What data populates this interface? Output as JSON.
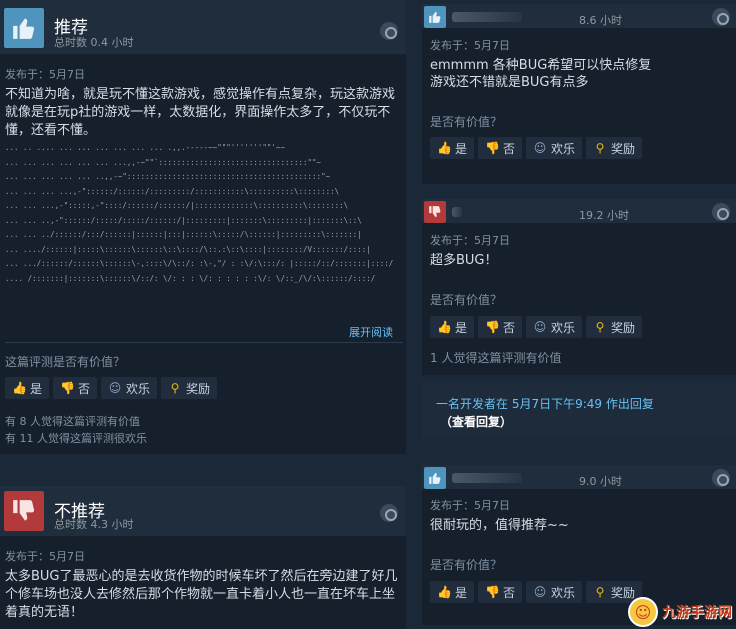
{
  "left": {
    "review1": {
      "verdict": "推荐",
      "hours": "总时数 0.4 小时",
      "posted": "发布于：5月7日",
      "text": "不知道为啥，就是玩不懂这款游戏，感觉操作有点复杂，玩这款游戏就像是在玩p社的游戏一样，太数据化，界面操作太多了，不仅玩不懂，还看不懂。",
      "ascii": [
        "... .. .... ... ... ... ... ... ... .,,.-----~~\"\"\"'''''''\"\"'~~",
        "... ... ... ... ... ... ...,,-~\"\"`:::::::::::::::::::::::::::::::::\"\"~",
        "... ... ... ... ... ..,,-~\":::::::::::::::::::::::::::::::::::::::::::\"~",
        "... ... ... ...,-\"::::::/::::::/:::::::::/:::::::::::\\::::::::::\\::::::::\\",
        "... ... ...,-\":::::,-\"::::/::::::/::::::/|:::::::::::::\\::::::::::\\::::::::\\",
        "... ... ..,-\"::::::/:::::/:::::/::::::/|:::::::::|:::::::\\:::::::::|:::::::\\::\\",
        "... ... ../::::::/:::/::::::|::::::|:::|::::::\\:::::/\\::::::|:::::::::\\:::::::|",
        "... ..../::::::|:::::\\::::::\\::::::\\::\\::::/\\::.:\\::\\::::|::::::::/V:::::::/::::|",
        "... .../::::::/::::::\\::::::\\-,::::\\/\\::/: :\\-,\"/ : :\\/:\\:::/: |:::::/::/:::::::|::::/",
        ".... /:::::::|:::::::\\::::::\\/::/: \\/: : : \\/: : : : : :\\/: \\/::_/\\/:\\::::::/::::/"
      ],
      "expand": "展开阅读",
      "question": "这篇评测是否有价值？",
      "buttons": {
        "yes": "是",
        "no": "否",
        "funny": "欢乐",
        "award": "奖励"
      },
      "stat1": "有 8 人觉得这篇评测有价值",
      "stat2": "有 11 人觉得这篇评测很欢乐"
    },
    "review2": {
      "verdict": "不推荐",
      "hours": "总时数 4.3 小时",
      "posted": "发布于：5月7日",
      "text": "太多BUG了最恶心的是去收货作物的时候车坏了然后在旁边建了好几个修车场也没人去修然后那个作物就一直卡着小人也一直在坏车上坐着真的无语！"
    }
  },
  "right": {
    "r1": {
      "hours": "8.6 小时",
      "posted": "发布于：5月7日",
      "line1": "emmmm 各种BUG希望可以快点修复",
      "line2": "游戏还不错就是BUG有点多",
      "question": "是否有价值？",
      "buttons": {
        "yes": "是",
        "no": "否",
        "funny": "欢乐",
        "award": "奖励"
      }
    },
    "r2": {
      "hours": "19.2 小时",
      "posted": "发布于：5月7日",
      "line1": "超多BUG！",
      "question": "是否有价值？",
      "buttons": {
        "yes": "是",
        "no": "否",
        "funny": "欢乐",
        "award": "奖励"
      },
      "stat": "1 人觉得这篇评测有价值",
      "dev_reply": "一名开发者在 5月7日下午9:49 作出回复",
      "dev_link": "（查看回复）"
    },
    "r3": {
      "hours": "9.0 小时",
      "posted": "发布于：5月7日",
      "line1": "很耐玩的，值得推荐~~",
      "question": "是否有价值？",
      "buttons": {
        "yes": "是",
        "no": "否",
        "funny": "欢乐",
        "award": "奖励"
      }
    }
  },
  "watermark": "九游手游网",
  "colors": {
    "accent": "#66c0f4",
    "up": "#4f94bc",
    "down": "#b33a3a",
    "award": "#e8b90d"
  }
}
